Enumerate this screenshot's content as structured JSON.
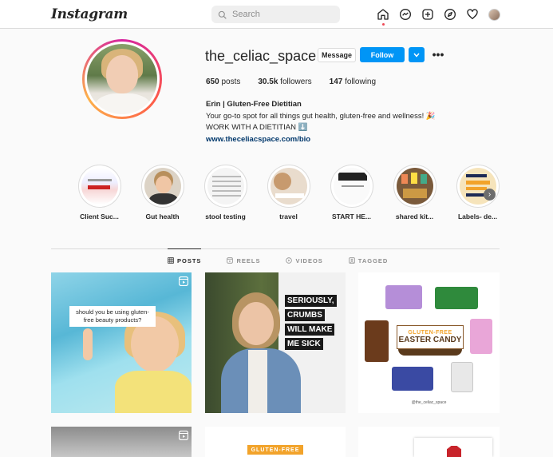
{
  "nav": {
    "logo": "Instagram",
    "search_placeholder": "Search"
  },
  "profile": {
    "username": "the_celiac_space",
    "message_label": "Message",
    "follow_label": "Follow",
    "stats": {
      "posts_count": "650",
      "posts_label": " posts",
      "followers_count": "30.5k",
      "followers_label": " followers",
      "following_count": "147",
      "following_label": " following"
    },
    "bio": {
      "name": "Erin | Gluten-Free Dietitian",
      "line1": "Your go-to spot for all things gut health, gluten-free and wellness! 🎉",
      "line2": "WORK WITH A DIETITIAN ⬇️",
      "link": "www.theceliacspace.com/bio"
    }
  },
  "highlights": [
    {
      "label": "Client Suc..."
    },
    {
      "label": "Gut health"
    },
    {
      "label": "stool testing"
    },
    {
      "label": "travel"
    },
    {
      "label": "START HE..."
    },
    {
      "label": "shared kit..."
    },
    {
      "label": "Labels- de..."
    }
  ],
  "tabs": [
    {
      "label": "POSTS",
      "active": true
    },
    {
      "label": "REELS",
      "active": false
    },
    {
      "label": "VIDEOS",
      "active": false
    },
    {
      "label": "TAGGED",
      "active": false
    }
  ],
  "posts": {
    "p1_caption": "should you be using gluten-free beauty products?",
    "p2_sign": [
      "SERIOUSLY,",
      "CRUMBS",
      "WILL MAKE",
      "ME SICK"
    ],
    "p3_title_small": "GLUTEN-FREE",
    "p3_title_big": "EASTER CANDY",
    "p3_handle": "@the_celiac_space",
    "p5_label": "GLUTEN-FREE"
  },
  "colors": {
    "follow_blue": "#0095f6",
    "link_blue": "#00376b",
    "notification_red": "#ed4956"
  }
}
